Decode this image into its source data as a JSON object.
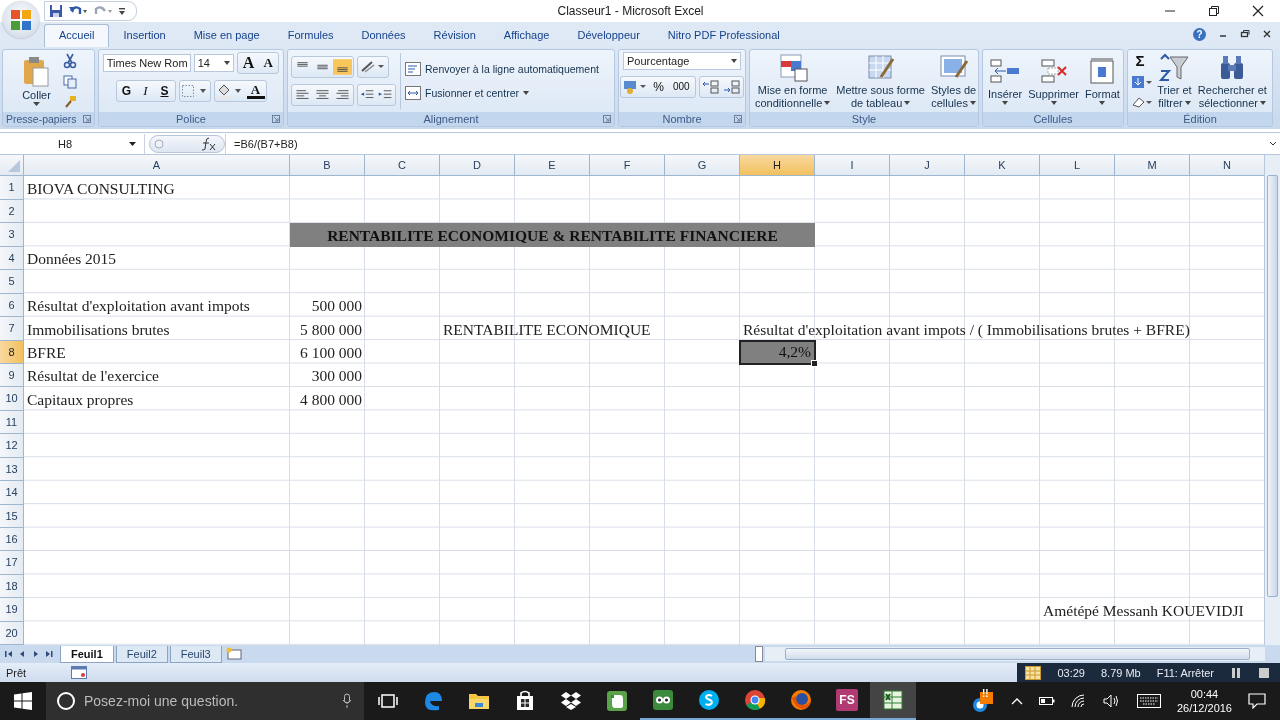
{
  "window": {
    "title": "Classeur1 - Microsoft Excel"
  },
  "ribbon_tabs": [
    {
      "label": "Accueil",
      "selected": true
    },
    {
      "label": "Insertion",
      "selected": false
    },
    {
      "label": "Mise en page",
      "selected": false
    },
    {
      "label": "Formules",
      "selected": false
    },
    {
      "label": "Données",
      "selected": false
    },
    {
      "label": "Révision",
      "selected": false
    },
    {
      "label": "Affichage",
      "selected": false
    },
    {
      "label": "Développeur",
      "selected": false
    },
    {
      "label": "Nitro PDF Professional",
      "selected": false
    }
  ],
  "help": "?",
  "clipboard": {
    "paste": "Coller",
    "group": "Presse-papiers"
  },
  "font": {
    "name": "Times New Rom",
    "size": "14",
    "grow": "A",
    "shrink": "A",
    "bold": "G",
    "italic": "I",
    "underline": "S",
    "color_letter": "A",
    "group": "Police"
  },
  "alignment": {
    "vertical": [
      {
        "selected": false
      },
      {
        "selected": false
      },
      {
        "selected": true
      }
    ],
    "wrap": "Renvoyer à la ligne automatiquement",
    "merge": "Fusionner et centrer",
    "group": "Alignement"
  },
  "number": {
    "format": "Pourcentage",
    "percent": "%",
    "thousands": "000",
    "group": "Nombre"
  },
  "style": {
    "group": "Style",
    "buttons": [
      {
        "kind": "conditional",
        "lines": [
          "Mise en forme",
          "conditionnelle"
        ]
      },
      {
        "kind": "table",
        "lines": [
          "Mettre sous forme",
          "de tableau"
        ]
      },
      {
        "kind": "cellstyle",
        "lines": [
          "Styles de",
          "cellules"
        ]
      }
    ]
  },
  "cells": {
    "group": "Cellules",
    "buttons": [
      {
        "kind": "insert",
        "lines": [
          "Insérer"
        ]
      },
      {
        "kind": "delete",
        "lines": [
          "Supprimer"
        ]
      },
      {
        "kind": "format",
        "lines": [
          "Format"
        ]
      }
    ]
  },
  "editing": {
    "group": "Édition",
    "sum": "Σ",
    "buttons": [
      {
        "kind": "sort",
        "lines": [
          "Trier et",
          "filtrer"
        ]
      },
      {
        "kind": "find",
        "lines": [
          "Rechercher et",
          "sélectionner"
        ]
      }
    ]
  },
  "formula_bar": {
    "name_box": "H8",
    "formula": "=B6/(B7+B8)"
  },
  "columns": [
    {
      "label": "A",
      "selected": false
    },
    {
      "label": "B",
      "selected": false
    },
    {
      "label": "C",
      "selected": false
    },
    {
      "label": "D",
      "selected": false
    },
    {
      "label": "E",
      "selected": false
    },
    {
      "label": "F",
      "selected": false
    },
    {
      "label": "G",
      "selected": false
    },
    {
      "label": "H",
      "selected": true
    },
    {
      "label": "I",
      "selected": false
    },
    {
      "label": "J",
      "selected": false
    },
    {
      "label": "K",
      "selected": false
    },
    {
      "label": "L",
      "selected": false
    },
    {
      "label": "M",
      "selected": false
    },
    {
      "label": "N",
      "selected": false
    }
  ],
  "rows": [
    {
      "number": "1",
      "selected": false,
      "cells": [
        {
          "kind": "text",
          "text": "BIOVA CONSULTING"
        }
      ]
    },
    {
      "number": "2",
      "selected": false,
      "cells": []
    },
    {
      "number": "3",
      "selected": false,
      "cells": [
        {
          "kind": "empty"
        },
        {
          "kind": "banner",
          "text": "RENTABILITE ECONOMIQUE & RENTABILITE FINANCIERE"
        },
        {
          "kind": "merged"
        },
        {
          "kind": "merged"
        },
        {
          "kind": "merged"
        },
        {
          "kind": "merged"
        },
        {
          "kind": "merged"
        },
        {
          "kind": "merged"
        }
      ]
    },
    {
      "number": "4",
      "selected": false,
      "cells": [
        {
          "kind": "text",
          "text": "Données 2015"
        }
      ]
    },
    {
      "number": "5",
      "selected": false,
      "cells": []
    },
    {
      "number": "6",
      "selected": false,
      "cells": [
        {
          "kind": "text",
          "text": "Résultat d'exploitation avant impots"
        },
        {
          "kind": "number",
          "text": "500 000"
        }
      ]
    },
    {
      "number": "7",
      "selected": false,
      "cells": [
        {
          "kind": "text",
          "text": "Immobilisations brutes"
        },
        {
          "kind": "number",
          "text": "5 800 000"
        },
        {
          "kind": "empty"
        },
        {
          "kind": "text",
          "text": "RENTABILITE ECONOMIQUE"
        },
        {
          "kind": "empty"
        },
        {
          "kind": "empty"
        },
        {
          "kind": "empty"
        },
        {
          "kind": "text",
          "text": "Résultat d'exploitation avant impots / ( Immobilisations brutes + BFRE)"
        }
      ]
    },
    {
      "number": "8",
      "selected": true,
      "cells": [
        {
          "kind": "text",
          "text": "BFRE"
        },
        {
          "kind": "number",
          "text": "6 100 000"
        },
        {
          "kind": "empty"
        },
        {
          "kind": "empty"
        },
        {
          "kind": "empty"
        },
        {
          "kind": "empty"
        },
        {
          "kind": "empty"
        },
        {
          "kind": "result",
          "selected": true,
          "text": "4,2%"
        }
      ]
    },
    {
      "number": "9",
      "selected": false,
      "cells": [
        {
          "kind": "text",
          "text": "Résultat de l'exercice"
        },
        {
          "kind": "number",
          "text": "300 000"
        }
      ]
    },
    {
      "number": "10",
      "selected": false,
      "cells": [
        {
          "kind": "text",
          "text": "Capitaux propres"
        },
        {
          "kind": "number",
          "text": "4 800 000"
        }
      ]
    },
    {
      "number": "11",
      "selected": false,
      "cells": []
    },
    {
      "number": "12",
      "selected": false,
      "cells": []
    },
    {
      "number": "13",
      "selected": false,
      "cells": []
    },
    {
      "number": "14",
      "selected": false,
      "cells": []
    },
    {
      "number": "15",
      "selected": false,
      "cells": []
    },
    {
      "number": "16",
      "selected": false,
      "cells": []
    },
    {
      "number": "17",
      "selected": false,
      "cells": []
    },
    {
      "number": "18",
      "selected": false,
      "cells": []
    },
    {
      "number": "19",
      "selected": false,
      "cells": [
        {
          "kind": "empty"
        },
        {
          "kind": "empty"
        },
        {
          "kind": "empty"
        },
        {
          "kind": "empty"
        },
        {
          "kind": "empty"
        },
        {
          "kind": "empty"
        },
        {
          "kind": "empty"
        },
        {
          "kind": "empty"
        },
        {
          "kind": "empty"
        },
        {
          "kind": "empty"
        },
        {
          "kind": "empty"
        },
        {
          "kind": "text",
          "text": "Amétépé Messanh KOUEVIDJI"
        }
      ]
    },
    {
      "number": "20",
      "selected": false,
      "cells": []
    }
  ],
  "sheets": [
    {
      "label": "Feuil1",
      "selected": true
    },
    {
      "label": "Feuil2",
      "selected": false
    },
    {
      "label": "Feuil3",
      "selected": false
    }
  ],
  "status": "Prêt",
  "recorder": {
    "time": "03:29",
    "size": "8.79 Mb",
    "stop_hint": "F11: Arrêter"
  },
  "taskbar": {
    "search_placeholder": "Posez-moi une question.",
    "time": "00:44",
    "date": "26/12/2016",
    "apps": [
      {
        "kind": "edge",
        "running": false,
        "active": false
      },
      {
        "kind": "folder",
        "running": false,
        "active": false
      },
      {
        "kind": "store",
        "running": false,
        "active": false
      },
      {
        "kind": "dropbox",
        "running": false,
        "active": false
      },
      {
        "kind": "evernote",
        "running": false,
        "active": false
      },
      {
        "kind": "owl",
        "running": true,
        "active": false
      },
      {
        "kind": "skype",
        "running": true,
        "active": false
      },
      {
        "kind": "chrome",
        "running": true,
        "active": false
      },
      {
        "kind": "firefox",
        "running": true,
        "active": false
      },
      {
        "kind": "text",
        "label": "FS",
        "running": true,
        "active": false
      },
      {
        "kind": "excel",
        "running": true,
        "active": true
      }
    ],
    "alert": "!!"
  }
}
